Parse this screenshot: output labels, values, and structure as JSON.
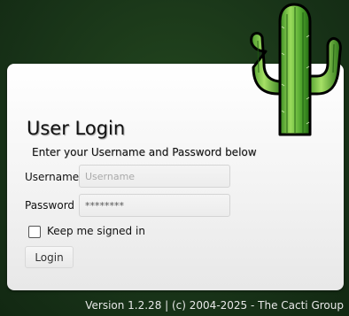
{
  "login": {
    "title": "User Login",
    "subtitle": "Enter your Username and Password below",
    "username_label": "Username",
    "username_placeholder": "Username",
    "password_label": "Password",
    "password_value": "********",
    "remember_label": "Keep me signed in",
    "remember_checked": false,
    "button_label": "Login"
  },
  "footer": {
    "version": "Version 1.2.28 | (c) 2004-2025 - The Cacti Group"
  },
  "logo": {
    "icon": "cactus-icon"
  },
  "colors": {
    "background": "#1c3a1b",
    "panel": "#f3f3f3",
    "cactus_light": "#8fd14f",
    "cactus_dark": "#2f7a1c"
  }
}
